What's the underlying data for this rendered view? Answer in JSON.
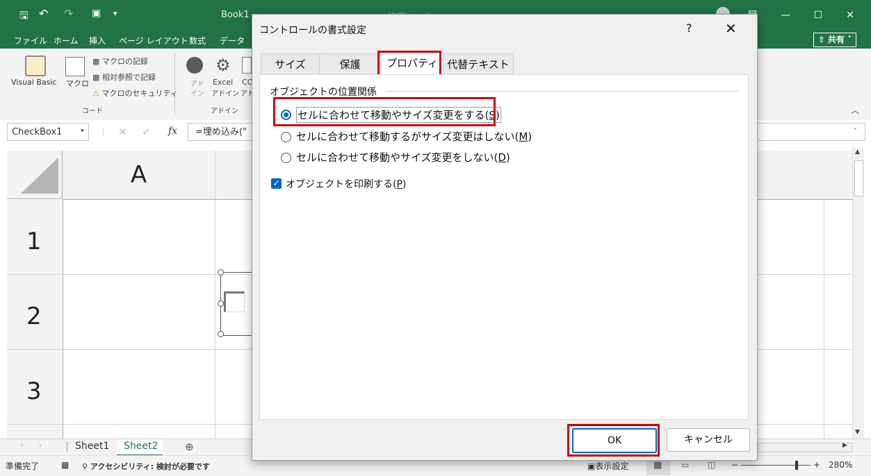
{
  "window": {
    "title_left": "Book1",
    "title_mid": "描画ツール"
  },
  "menu": {
    "items": [
      "ファイル",
      "ホーム",
      "挿入",
      "ページ レイアウト",
      "数式",
      "データ"
    ],
    "share": "共有"
  },
  "ribbon": {
    "visual_basic": "Visual Basic",
    "macro": "マクロ",
    "record_macro": "マクロの記録",
    "relative_ref": "相対参照で記録",
    "macro_security": "マクロのセキュリティ",
    "group_code": "コード",
    "addin_1a": "アド",
    "addin_1b": "イン",
    "addin_excel_a": "Excel",
    "addin_excel_b": "アドイン",
    "addin_com_a": "CO",
    "addin_com_b": "アド",
    "group_addin": "アドイン"
  },
  "formula_bar": {
    "name_box": "CheckBox1",
    "formula": "=埋め込み(\"",
    "fx": "fx"
  },
  "grid": {
    "col_a": "A",
    "rows": [
      "1",
      "2",
      "3"
    ]
  },
  "sheets": {
    "tabs": [
      "Sheet1",
      "Sheet2"
    ],
    "active": "Sheet2"
  },
  "status": {
    "ready": "準備完了",
    "accessibility": "アクセシビリティ: 検討が必要です",
    "display_settings": "表示設定",
    "zoom": "280%"
  },
  "dialog": {
    "title": "コントロールの書式設定",
    "help": "?",
    "close": "✕",
    "tabs": [
      "サイズ",
      "保護",
      "プロパティ",
      "代替テキスト"
    ],
    "active_tab": "プロパティ",
    "group_label": "オブジェクトの位置関係",
    "options": [
      {
        "label": "セルに合わせて移動やサイズ変更をする(",
        "key": "S",
        "selected": true
      },
      {
        "label": "セルに合わせて移動するがサイズ変更はしない(",
        "key": "M",
        "selected": false
      },
      {
        "label": "セルに合わせて移動やサイズ変更をしない(",
        "key": "D",
        "selected": false
      }
    ],
    "print_label": "オブジェクトを印刷する(",
    "print_key": "P",
    "print_checked": true,
    "ok": "OK",
    "cancel": "キャンセル"
  },
  "colors": {
    "excel_green": "#217346",
    "highlight_red": "#d00000",
    "accent_blue": "#0067c0"
  }
}
